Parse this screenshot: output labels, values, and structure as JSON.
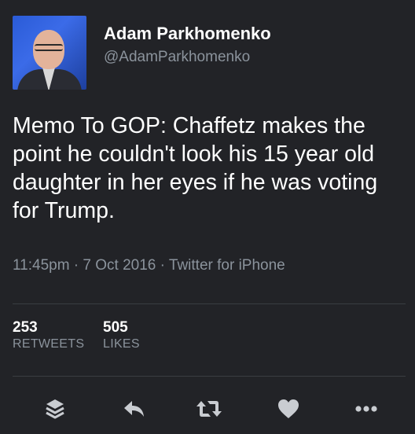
{
  "user": {
    "name": "Adam Parkhomenko",
    "handle": "@AdamParkhomenko"
  },
  "tweet": {
    "text": "Memo To GOP: Chaffetz makes the point he couldn't look his 15 year old daughter in her eyes if he was voting for Trump.",
    "meta": "11:45pm · 7 Oct 2016 · Twitter for iPhone"
  },
  "stats": {
    "retweets_count": "253",
    "retweets_label": "RETWEETS",
    "likes_count": "505",
    "likes_label": "LIKES"
  },
  "actions": {
    "icons": [
      "stack-icon",
      "reply-icon",
      "retweet-icon",
      "heart-icon",
      "more-icon"
    ]
  },
  "colors": {
    "background": "#222327",
    "primary_text": "#ffffff",
    "secondary_text": "#8b939c",
    "divider": "#3a3d42",
    "icon": "#c9ccd1"
  }
}
